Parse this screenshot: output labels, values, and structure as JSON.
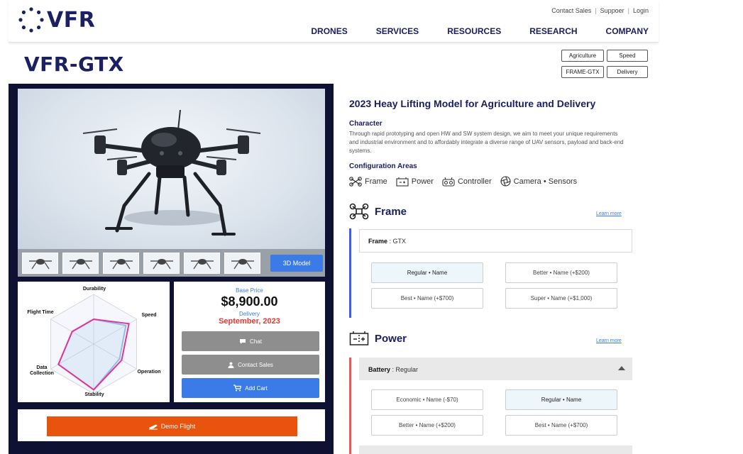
{
  "header": {
    "logo_text": "VFR",
    "util_links": [
      "Contact Sales",
      "Suppoer",
      "Login"
    ],
    "nav": [
      "DRONES",
      "SERVICES",
      "RESOURCES",
      "RESEARCH",
      "COMPANY"
    ]
  },
  "product": {
    "title": "VFR-GTX",
    "tags": [
      "Agriculture",
      "Speed",
      "FRAME-GTX",
      "Delivery"
    ]
  },
  "gallery": {
    "thumbnail_count": 6,
    "model_button": "3D Model"
  },
  "radar": {
    "axes": [
      "Durability",
      "Speed",
      "Operation",
      "Stability",
      "Data Collection",
      "Flight Time"
    ],
    "series_a": [
      0.5,
      0.82,
      0.65,
      0.92,
      0.82,
      0.5
    ],
    "series_b": [
      0.5,
      0.75,
      0.6,
      0.92,
      0.82,
      0.5
    ],
    "colors": {
      "series_a": "#e0359a",
      "series_b": "#8fbde8"
    }
  },
  "pricing": {
    "base_price_label": "Base Price",
    "base_price": "$8,900.00",
    "delivery_label": "Delivery",
    "delivery_date": "September, 2023",
    "chat_label": "Chat",
    "contact_label": "Contact Sales",
    "cart_label": "Add Cart"
  },
  "demo_label": "Demo Flight",
  "details": {
    "title": "2023 Heay Lifting Model for Agriculture and Delivery",
    "character_heading": "Character",
    "character_text": "Through rapid prototyping and open HW and SW system design, we aim to meet your unique requirements and industrial environment and to affordably integrate a diverse range of UAV sensors, payload and back-end systems.",
    "config_heading": "Configuration Areas",
    "config_items": [
      "Frame",
      "Power",
      "Controller",
      "Camera • Sensors"
    ]
  },
  "frame_section": {
    "title": "Frame",
    "learn_more": "Learn more",
    "selected_label": "Frame",
    "selected_value": " : GTX",
    "options": [
      "Regular • Name",
      "Better • Name (+$200)",
      "Best • Name (+$700)",
      "Super • Name (+$1,000)"
    ],
    "accent": "#3a5fe8"
  },
  "power_section": {
    "title": "Power",
    "learn_more": "Learn more",
    "battery_label": "Battery",
    "battery_value": " : Regular",
    "options": [
      "Economic • Name (-$70)",
      "Regular • Name",
      "Better • Name (+$200)",
      "Best • Name (+$700)"
    ],
    "accent": "#e85a5a"
  }
}
